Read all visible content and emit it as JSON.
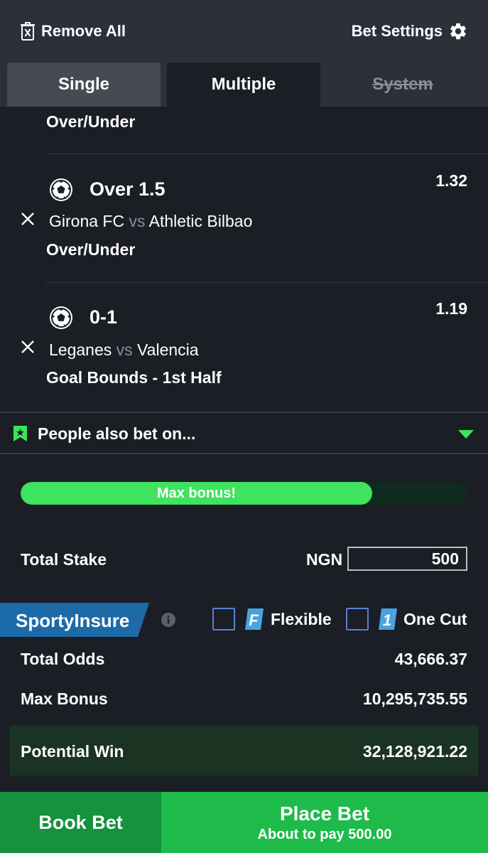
{
  "header": {
    "remove_all": "Remove All",
    "bet_settings": "Bet Settings"
  },
  "tabs": [
    {
      "label": "Single",
      "state": "inactive"
    },
    {
      "label": "Multiple",
      "state": "active"
    },
    {
      "label": "System",
      "state": "disabled"
    }
  ],
  "bets": [
    {
      "market": "Over/Under"
    },
    {
      "pick": "Over 1.5",
      "odds": "1.32",
      "home": "Girona FC",
      "vs": "vs",
      "away": "Athletic Bilbao",
      "market": "Over/Under",
      "icon": "soccer-ball-icon"
    },
    {
      "pick": "0-1",
      "odds": "1.19",
      "home": "Leganes",
      "vs": "vs",
      "away": "Valencia",
      "market": "Goal Bounds - 1st Half",
      "icon": "soccer-ball-icon"
    }
  ],
  "people_also_bet": "People also bet on...",
  "bonus_bar": {
    "label": "Max bonus!",
    "fill_fraction": 0.785
  },
  "stake": {
    "label": "Total Stake",
    "currency": "NGN",
    "value": "500"
  },
  "insure": {
    "brand": "SportyInsure",
    "options": [
      {
        "badge": "F",
        "label": "Flexible",
        "checked": false
      },
      {
        "badge": "1",
        "label": "One Cut",
        "checked": false
      }
    ]
  },
  "summary": {
    "total_odds_label": "Total Odds",
    "total_odds": "43,666.37",
    "max_bonus_label": "Max Bonus",
    "max_bonus": "10,295,735.55",
    "potential_win_label": "Potential Win",
    "potential_win": "32,128,921.22"
  },
  "actions": {
    "book_bet": "Book Bet",
    "place_bet": "Place Bet",
    "place_bet_sub": "About to pay 500.00"
  },
  "colors": {
    "background": "#1b1e25",
    "header": "#2d3039",
    "accent_green": "#3ee35f",
    "book_bet": "#16913c",
    "place_bet": "#1ebb4a",
    "insure_blue": "#1d6aa8"
  }
}
